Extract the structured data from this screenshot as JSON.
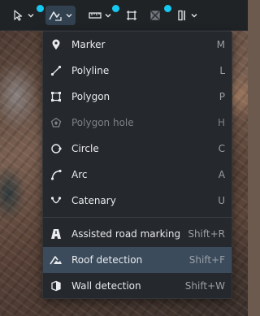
{
  "toolbar": {
    "buttons": [
      {
        "name": "select-tool",
        "icon": "cursor-arrow-icon",
        "has_dropdown": true,
        "has_badge": true
      },
      {
        "name": "draw-tool",
        "icon": "draw-shapes-icon",
        "has_dropdown": true,
        "active": true
      },
      {
        "name": "measure-tool",
        "icon": "ruler-icon",
        "has_dropdown": true,
        "has_badge": true
      },
      {
        "name": "frame-tool",
        "icon": "frame-corners-icon",
        "has_dropdown": false
      },
      {
        "name": "clip-tool",
        "icon": "crossed-square-icon",
        "has_dropdown": false,
        "has_badge": true
      },
      {
        "name": "section-tool",
        "icon": "section-split-icon",
        "has_dropdown": true
      }
    ],
    "badge_color": "#17c8f0"
  },
  "menu": {
    "items": [
      {
        "label": "Marker",
        "shortcut": "M",
        "icon": "marker-pin-icon",
        "disabled": false
      },
      {
        "label": "Polyline",
        "shortcut": "L",
        "icon": "polyline-icon",
        "disabled": false
      },
      {
        "label": "Polygon",
        "shortcut": "P",
        "icon": "polygon-icon",
        "disabled": false
      },
      {
        "label": "Polygon hole",
        "shortcut": "H",
        "icon": "polygon-hole-icon",
        "disabled": true
      },
      {
        "label": "Circle",
        "shortcut": "C",
        "icon": "circle-icon",
        "disabled": false
      },
      {
        "label": "Arc",
        "shortcut": "A",
        "icon": "arc-icon",
        "disabled": false
      },
      {
        "label": "Catenary",
        "shortcut": "U",
        "icon": "catenary-icon",
        "disabled": false
      },
      {
        "label": "Assisted road marking",
        "shortcut": "Shift+R",
        "icon": "road-marking-icon",
        "disabled": false
      },
      {
        "label": "Roof detection",
        "shortcut": "Shift+F",
        "icon": "roof-detection-icon",
        "disabled": false,
        "selected": true
      },
      {
        "label": "Wall detection",
        "shortcut": "Shift+W",
        "icon": "wall-detection-icon",
        "disabled": false
      }
    ]
  },
  "colors": {
    "toolbar_bg": "#202326",
    "menu_bg": "#25282c",
    "selected_bg": "#3b4b5c",
    "accent": "#17c8f0"
  }
}
